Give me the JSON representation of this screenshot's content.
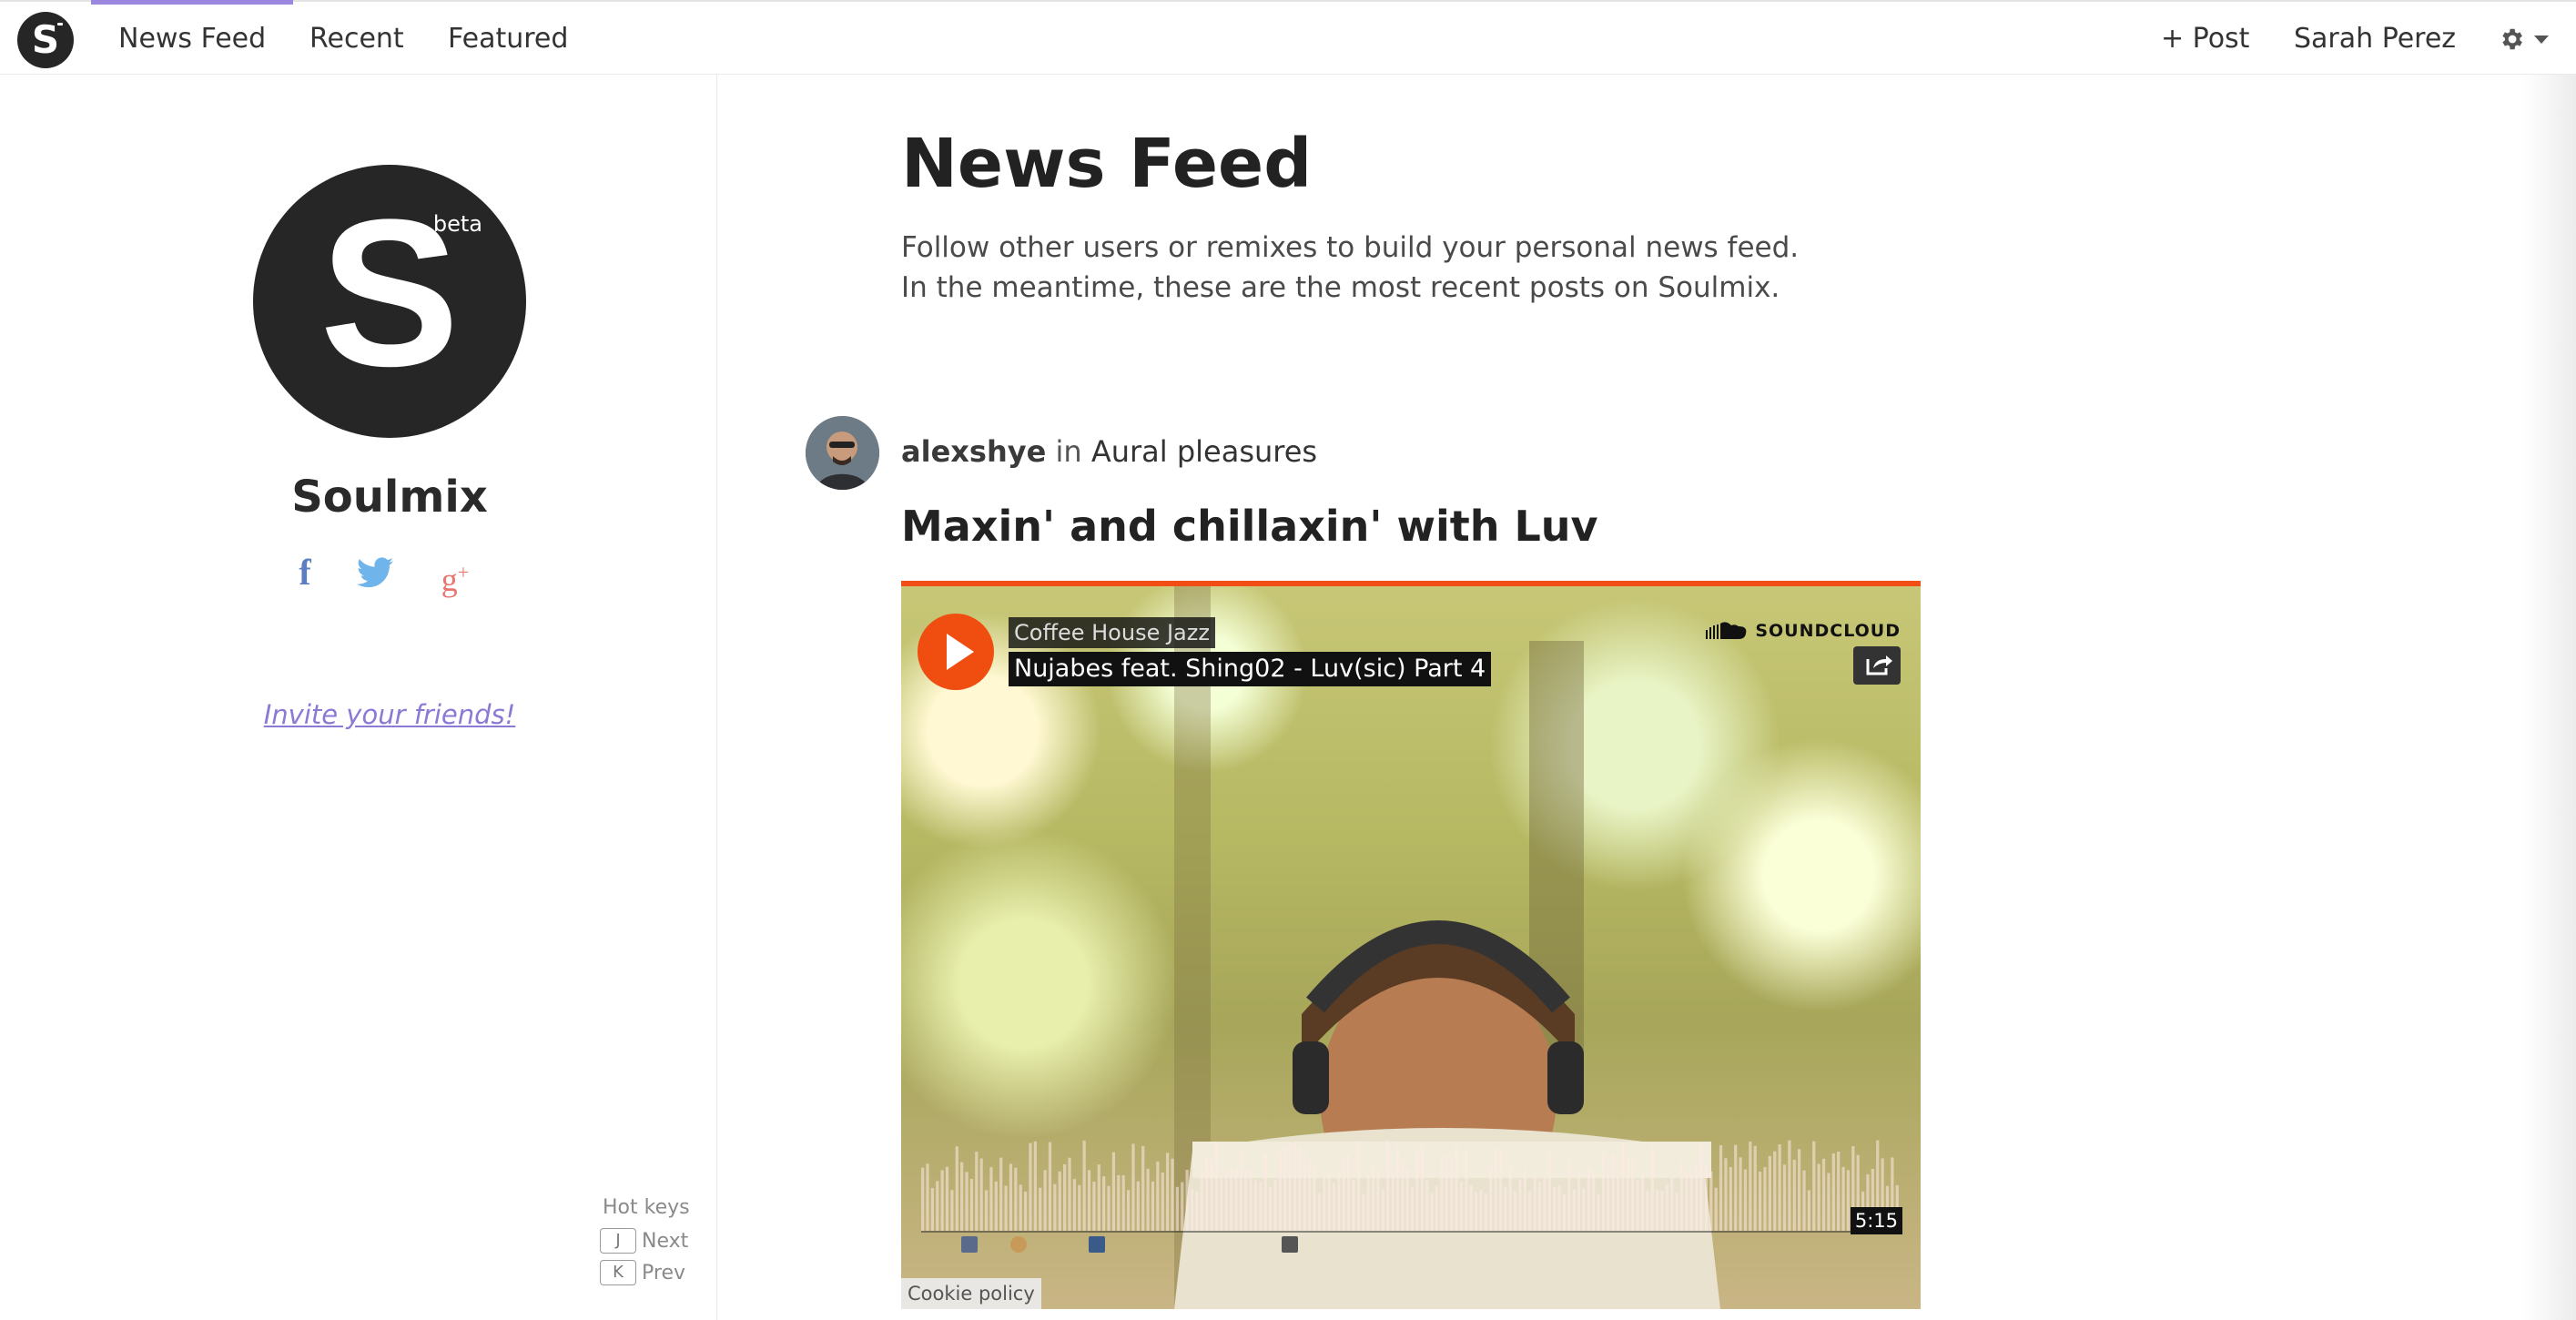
{
  "nav": {
    "logo_letter": "S",
    "tabs": [
      {
        "label": "News Feed",
        "active": true
      },
      {
        "label": "Recent",
        "active": false
      },
      {
        "label": "Featured",
        "active": false
      }
    ],
    "post_label": "+ Post",
    "user_name": "Sarah Perez",
    "settings_icon": "gear-icon",
    "accent_color": "#9b86e0"
  },
  "sidebar": {
    "logo_letter": "S",
    "logo_badge": "beta",
    "site_name": "Soulmix",
    "social_icons": [
      {
        "name": "facebook-icon",
        "glyph": "f",
        "color": "#5b7ec4"
      },
      {
        "name": "twitter-icon",
        "glyph": "twitter-bird",
        "color": "#6fb4ea"
      },
      {
        "name": "google-plus-icon",
        "glyph": "g+",
        "color": "#e8766e"
      }
    ],
    "invite_link": "Invite your friends!",
    "hotkeys": {
      "title": "Hot keys",
      "next": {
        "key": "J",
        "label": "Next"
      },
      "prev": {
        "key": "K",
        "label": "Prev"
      }
    }
  },
  "main": {
    "title": "News Feed",
    "intro_line1": "Follow other users or remixes to build your personal news feed.",
    "intro_line2": "In the meantime, these are the most recent posts on Soulmix.",
    "post": {
      "author": "alexshye",
      "in_word": "in",
      "collection": "Aural pleasures",
      "title": "Maxin' and chillaxin' with Luv",
      "embed": {
        "genre": "Coffee House Jazz",
        "track": "Nujabes feat. Shing02 - Luv(sic) Part 4",
        "brand": "SOUNDCLOUD",
        "duration": "5:15",
        "cookie_policy": "Cookie policy",
        "accent_color": "#f24d14"
      }
    }
  }
}
